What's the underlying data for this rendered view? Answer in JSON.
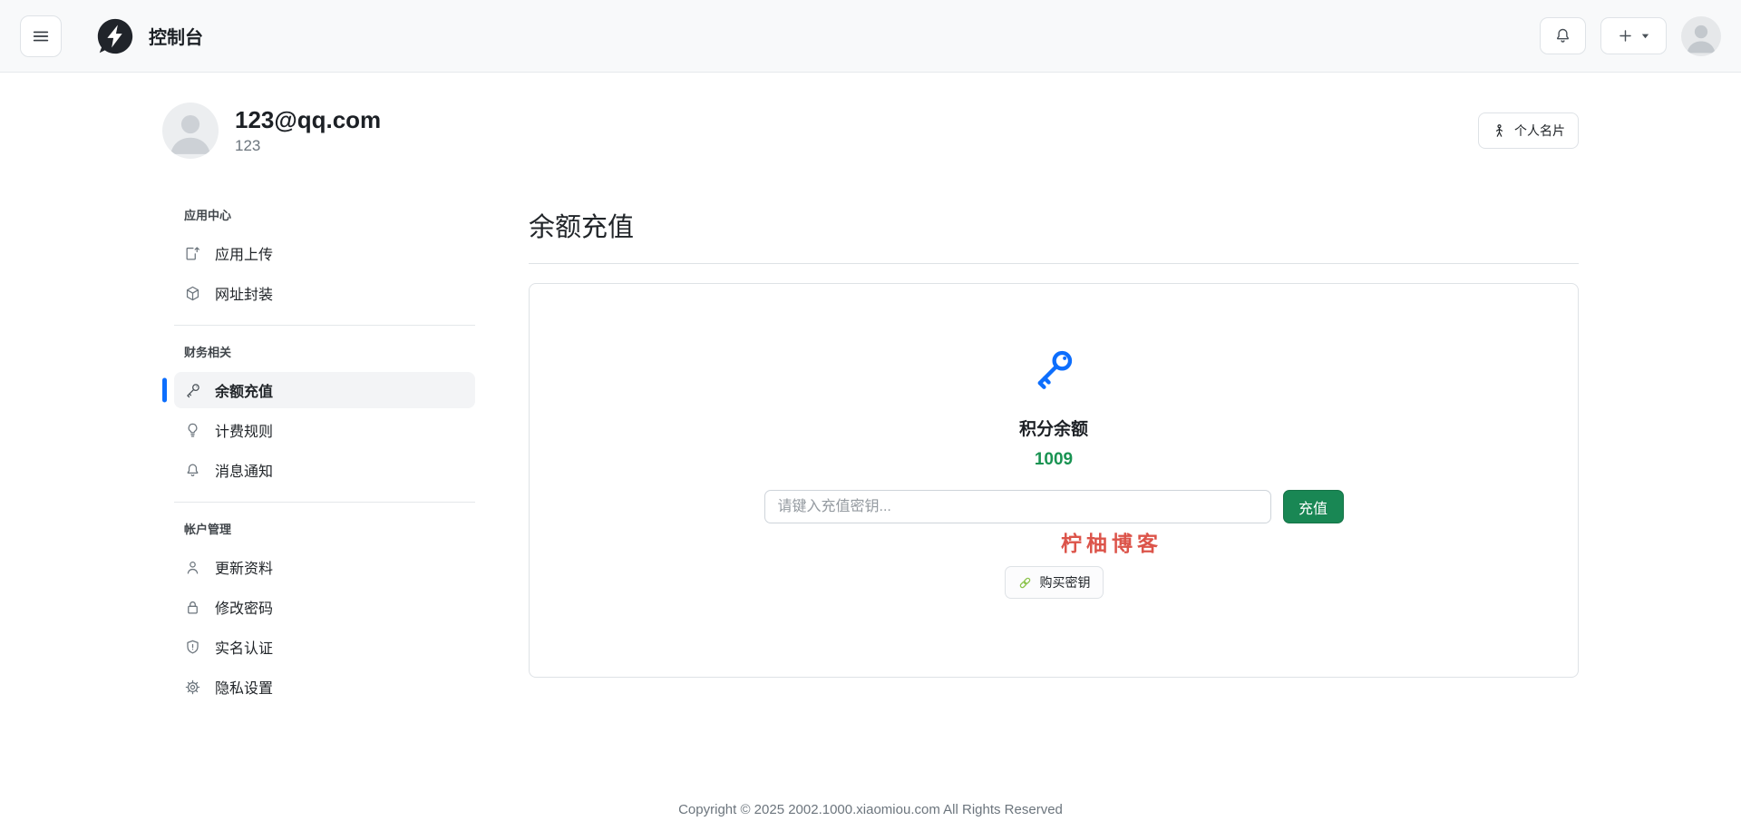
{
  "navbar": {
    "title": "控制台"
  },
  "profile": {
    "email": "123@qq.com",
    "username": "123",
    "card_button_label": "个人名片"
  },
  "sidebar": {
    "sections": [
      {
        "header": "应用中心",
        "items": [
          {
            "label": "应用上传",
            "icon": "upload-icon"
          },
          {
            "label": "网址封装",
            "icon": "box-icon"
          }
        ]
      },
      {
        "header": "财务相关",
        "items": [
          {
            "label": "余额充值",
            "icon": "key-icon",
            "active": true
          },
          {
            "label": "计费规则",
            "icon": "lightbulb-icon"
          },
          {
            "label": "消息通知",
            "icon": "bell-icon"
          }
        ]
      },
      {
        "header": "帐户管理",
        "items": [
          {
            "label": "更新资料",
            "icon": "person-icon"
          },
          {
            "label": "修改密码",
            "icon": "lock-icon"
          },
          {
            "label": "实名认证",
            "icon": "shield-exclamation-icon"
          },
          {
            "label": "隐私设置",
            "icon": "gear-icon"
          }
        ]
      }
    ]
  },
  "main": {
    "page_title": "余额充值",
    "balance_label": "积分余额",
    "balance_value": "1009",
    "input_placeholder": "请键入充值密钥...",
    "recharge_button_label": "充值",
    "watermark_text": "柠柚博客",
    "buy_key_button_label": "购买密钥"
  },
  "footer": {
    "copyright": "Copyright © 2025 2002.1000.xiaomiou.com All Rights Reserved"
  },
  "colors": {
    "accent_blue": "#0d6efd",
    "success_green": "#198754",
    "balance_green": "#199352",
    "watermark_red": "#dc544a",
    "link_green": "#8bc34a",
    "navbar_bg": "#f8f9fa"
  }
}
